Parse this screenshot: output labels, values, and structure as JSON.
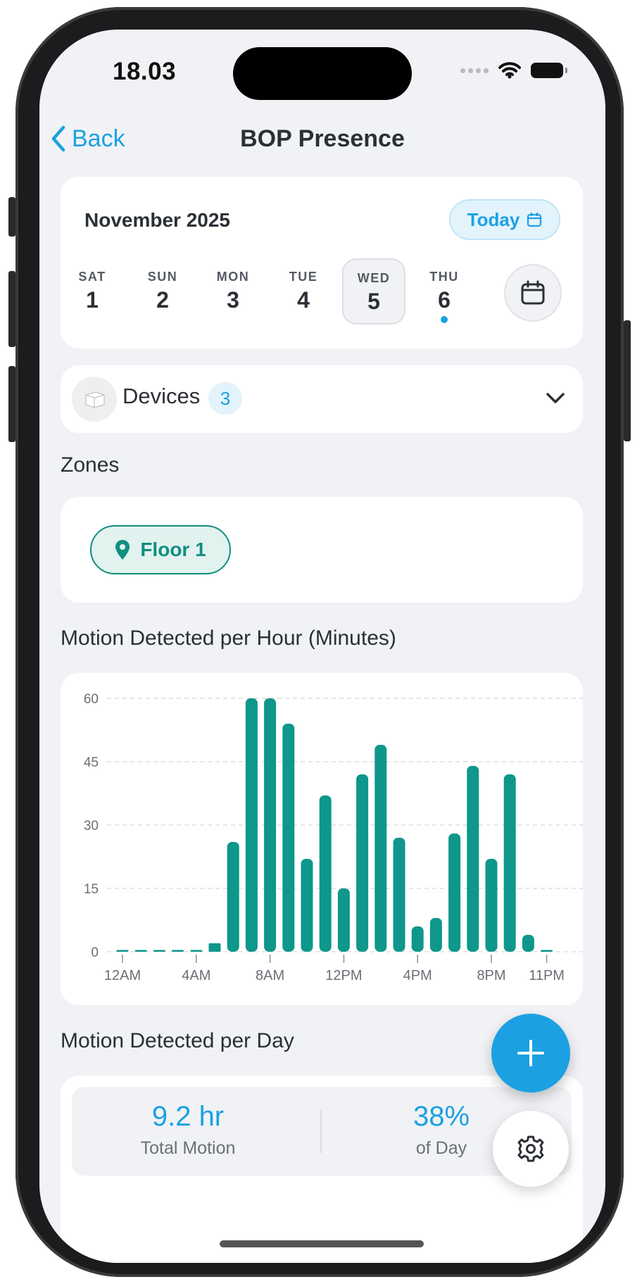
{
  "status_bar": {
    "time": "18.03"
  },
  "nav": {
    "back_label": "Back",
    "title": "BOP Presence"
  },
  "date_picker": {
    "month_label": "November 2025",
    "today_label": "Today",
    "days": [
      {
        "dow": "SAT",
        "num": "1",
        "selected": false,
        "has_data": false
      },
      {
        "dow": "SUN",
        "num": "2",
        "selected": false,
        "has_data": false
      },
      {
        "dow": "MON",
        "num": "3",
        "selected": false,
        "has_data": false
      },
      {
        "dow": "TUE",
        "num": "4",
        "selected": false,
        "has_data": false
      },
      {
        "dow": "WED",
        "num": "5",
        "selected": true,
        "has_data": false
      },
      {
        "dow": "THU",
        "num": "6",
        "selected": false,
        "has_data": true
      }
    ]
  },
  "devices": {
    "label": "Devices",
    "count": "3"
  },
  "zones": {
    "heading": "Zones",
    "items": [
      {
        "label": "Floor 1"
      }
    ]
  },
  "hourly_section": {
    "heading": "Motion Detected per Hour (Minutes)"
  },
  "chart_data": {
    "type": "bar",
    "title": "Motion Detected per Hour (Minutes)",
    "xlabel": "",
    "ylabel": "",
    "ylim": [
      0,
      60
    ],
    "yticks": [
      0,
      15,
      30,
      45,
      60
    ],
    "grid": true,
    "color": "#0e978a",
    "categories": [
      "12AM",
      "1AM",
      "2AM",
      "3AM",
      "4AM",
      "5AM",
      "6AM",
      "7AM",
      "8AM",
      "9AM",
      "10AM",
      "11AM",
      "12PM",
      "1PM",
      "2PM",
      "3PM",
      "4PM",
      "5PM",
      "6PM",
      "7PM",
      "8PM",
      "9PM",
      "10PM",
      "11PM"
    ],
    "xtick_labels": [
      "12AM",
      "4AM",
      "8AM",
      "12PM",
      "4PM",
      "8PM",
      "11PM"
    ],
    "values": [
      0,
      0,
      0,
      0,
      0,
      2,
      26,
      60,
      60,
      54,
      22,
      37,
      15,
      42,
      49,
      27,
      6,
      8,
      28,
      44,
      22,
      42,
      4,
      0
    ]
  },
  "daily_section": {
    "heading": "Motion Detected per Day",
    "total_value": "9.2 hr",
    "total_label": "Total Motion",
    "pct_value": "38%",
    "pct_label": "of Day"
  },
  "colors": {
    "accent": "#1ba1e2",
    "teal": "#0e978a",
    "background": "#f1f2f5"
  },
  "icons": {
    "add": "plus-icon",
    "settings": "gear-icon",
    "calendar": "calendar-icon",
    "zone": "location-pin-icon"
  }
}
